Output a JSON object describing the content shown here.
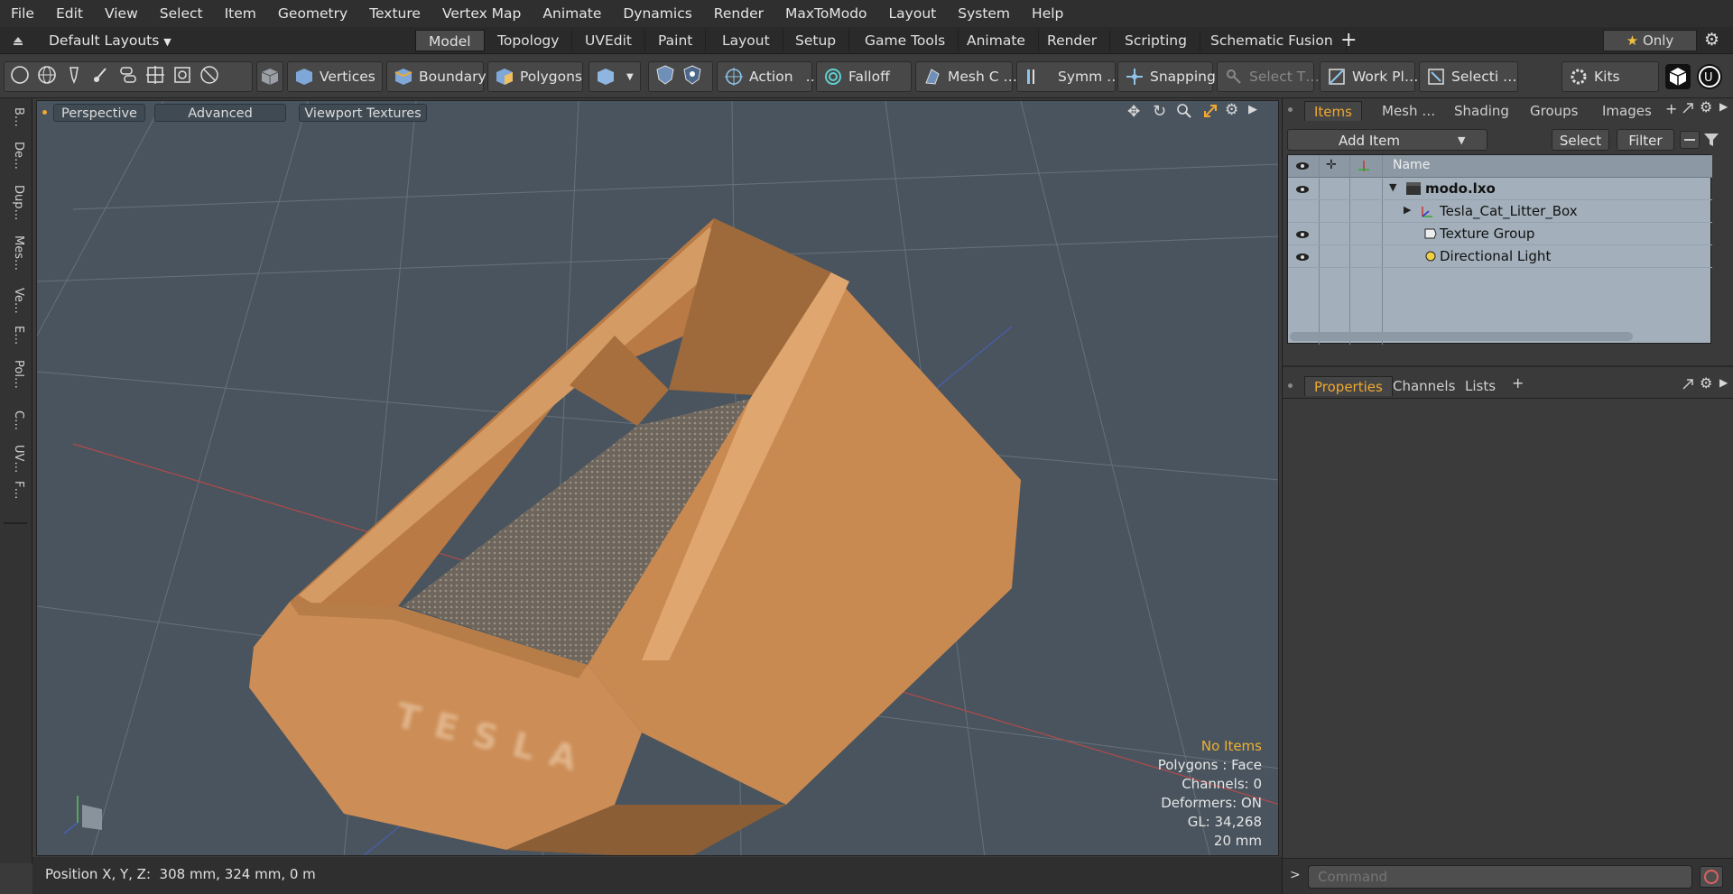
{
  "menu": [
    "File",
    "Edit",
    "View",
    "Select",
    "Item",
    "Geometry",
    "Texture",
    "Vertex Map",
    "Animate",
    "Dynamics",
    "Render",
    "MaxToModo",
    "Layout",
    "System",
    "Help"
  ],
  "layout_selector": "Default Layouts",
  "layout_tabs": [
    "Model",
    "Topology",
    "UVEdit",
    "Paint",
    "Layout",
    "Setup",
    "Game Tools",
    "Animate",
    "Render",
    "Scripting",
    "Schematic Fusion"
  ],
  "only_label": "Only",
  "toolbar": {
    "vertices": "Vertices",
    "boundary": "Boundary",
    "polygons": "Polygons",
    "action": "Action",
    "action_more": "…",
    "falloff": "Falloff",
    "mesh": "Mesh C …",
    "symm": "Symm …",
    "snapping": "Snapping",
    "select_t": "Select T…",
    "work_pl": "Work Pl…",
    "selecti": "Selecti …",
    "kits": "Kits"
  },
  "left_tabs": [
    "B…",
    "De…",
    "Dup…",
    "Mes…",
    "Ve…",
    "E…",
    "Pol…",
    "C…",
    "UV…",
    "F…"
  ],
  "viewport": {
    "perspective": "Perspective",
    "advanced": "Advanced",
    "viewport_textures": "Viewport Textures",
    "stats": {
      "no_items": "No Items",
      "polygons": "Polygons : Face",
      "channels": "Channels: 0",
      "deformers": "Deformers: ON",
      "gl": "GL: 34,268",
      "scale": "20 mm"
    },
    "model_text": "TESLA"
  },
  "status": {
    "position": "Position X, Y, Z:  308 mm, 324 mm, 0 m"
  },
  "items_panel": {
    "tabs": [
      "Items",
      "Mesh …",
      "Shading",
      "Groups",
      "Images"
    ],
    "add_item": "Add Item",
    "select": "Select",
    "filter": "Filter",
    "name_header": "Name",
    "rows": [
      {
        "label": "modo.lxo",
        "bold": true
      },
      {
        "label": "Tesla_Cat_Litter_Box",
        "bold": false
      },
      {
        "label": "Texture Group",
        "bold": false
      },
      {
        "label": "Directional Light",
        "bold": false
      }
    ]
  },
  "props_panel": {
    "tabs": [
      "Properties",
      "Channels",
      "Lists"
    ]
  },
  "command": {
    "placeholder": "Command",
    "prompt": ">"
  },
  "colors": {
    "accent": "#f0a830",
    "viewport_bg": "#49545e",
    "cardboard": "#c98a52"
  }
}
